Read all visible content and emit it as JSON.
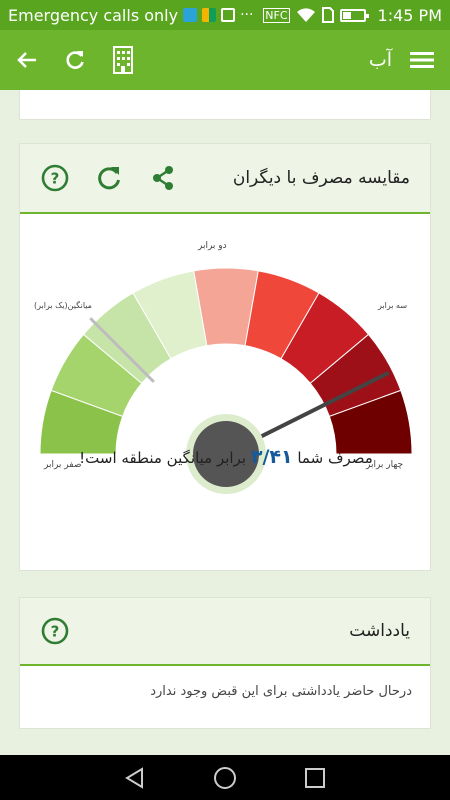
{
  "status_bar": {
    "carrier": "Emergency calls only",
    "time": "1:45 PM",
    "nfc_label": "NFC"
  },
  "app_bar": {
    "title": "آب",
    "icons": [
      "menu-icon",
      "building-icon",
      "refresh-icon",
      "back-arrow-icon"
    ]
  },
  "comparison_card": {
    "title": "مقایسه مصرف با دیگران",
    "icons": [
      "help-icon",
      "refresh-icon",
      "share-icon"
    ],
    "gauge": {
      "labels": {
        "zero": "صفر برابر",
        "average": "میانگین(یک برابر)",
        "double": "دو برابر",
        "triple": "سه برابر",
        "quadruple": "چهار برابر"
      },
      "value": 3.41,
      "max": 4,
      "average_marker": 1,
      "colors": [
        "#8bc34a",
        "#a5d36c",
        "#c6e4a8",
        "#e0f0cc",
        "#f4a596",
        "#ef473a",
        "#c81d25",
        "#9e1017",
        "#6e0000"
      ]
    },
    "result_prefix": "مصرف شما",
    "result_value": "۳/۴۱",
    "result_suffix": "برابر میانگین منطقه است!"
  },
  "note_card": {
    "title": "یادداشت",
    "icon": "help-icon",
    "body": "درحال حاضر یادداشتی برای این قبض وجود ندارد"
  },
  "nav_bar": {
    "icons": [
      "back-triangle-icon",
      "home-circle-icon",
      "recents-square-icon"
    ]
  }
}
